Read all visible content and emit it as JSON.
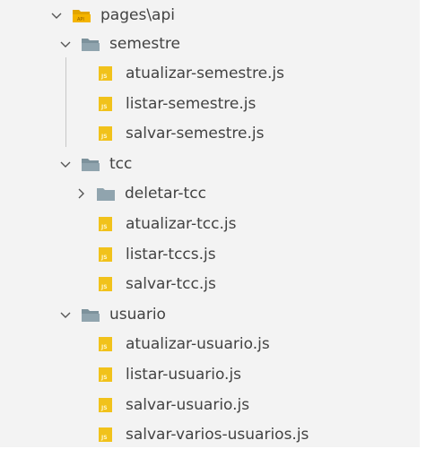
{
  "explorer": {
    "root": {
      "label": "pages\\api",
      "expanded": true
    },
    "semestre": {
      "label": "semestre",
      "expanded": true,
      "files": [
        "atualizar-semestre.js",
        "listar-semestre.js",
        "salvar-semestre.js"
      ]
    },
    "tcc": {
      "label": "tcc",
      "expanded": true,
      "subfolder": {
        "label": "deletar-tcc",
        "expanded": false
      },
      "files": [
        "atualizar-tcc.js",
        "listar-tccs.js",
        "salvar-tcc.js"
      ]
    },
    "usuario": {
      "label": "usuario",
      "expanded": true,
      "files": [
        "atualizar-usuario.js",
        "listar-usuario.js",
        "salvar-usuario.js",
        "salvar-varios-usuarios.js"
      ]
    }
  },
  "icons": {
    "expanded": "chevron-down-icon",
    "collapsed": "chevron-right-icon",
    "folder": "folder-icon",
    "folder_open": "folder-open-icon",
    "js_file": "js-file-icon"
  },
  "colors": {
    "background": "#f3f3f3",
    "text": "#424242",
    "folder": "#90a4ae",
    "root_folder": "#f4b400",
    "js_badge": "#f1c21b"
  }
}
